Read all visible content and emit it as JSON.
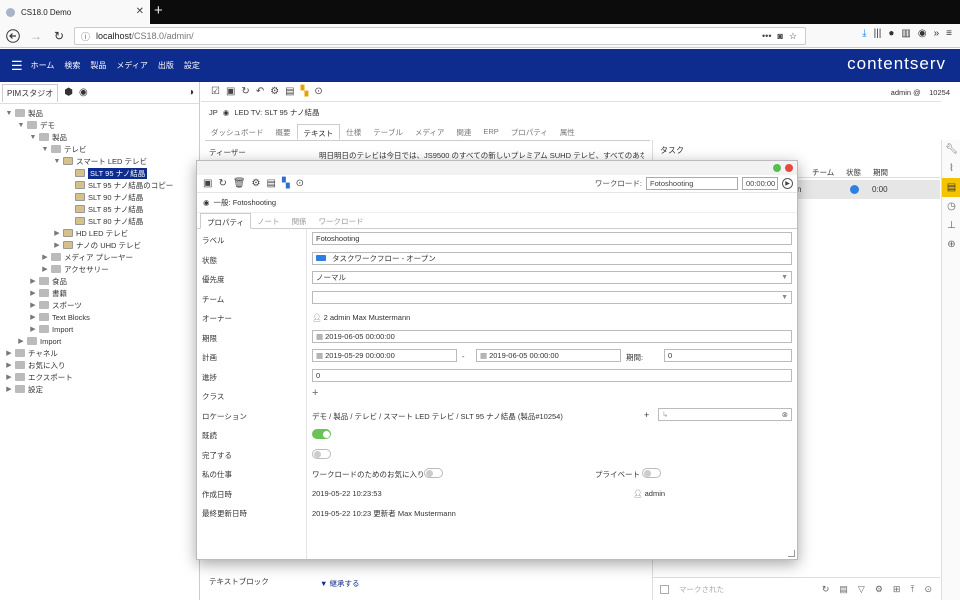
{
  "browser": {
    "tab_title": "CS18.0 Demo",
    "url_host": "localhost",
    "url_path": "/CS18.0/admin/"
  },
  "app": {
    "brand": "contentserv",
    "menu": [
      "ホーム",
      "検索",
      "製品",
      "メディア",
      "出版",
      "設定"
    ],
    "user": "admin @",
    "user_id": "10254"
  },
  "left": {
    "tab_label": "PIMスタジオ",
    "tree": [
      {
        "label": "製品",
        "toggle": "▼",
        "indent": 0
      },
      {
        "label": "デモ",
        "toggle": "▼",
        "indent": 1
      },
      {
        "label": "製品",
        "toggle": "▼",
        "indent": 2
      },
      {
        "label": "テレビ",
        "toggle": "▼",
        "indent": 3
      },
      {
        "label": "スマート LED テレビ",
        "toggle": "▼",
        "indent": 4
      },
      {
        "label": "SLT 95 ナノ結晶",
        "toggle": "",
        "indent": 5,
        "selected": true
      },
      {
        "label": "SLT 95 ナノ結晶のコピー",
        "toggle": "",
        "indent": 5
      },
      {
        "label": "SLT 90 ナノ結晶",
        "toggle": "",
        "indent": 5
      },
      {
        "label": "SLT 85 ナノ結晶",
        "toggle": "",
        "indent": 5
      },
      {
        "label": "SLT 80 ナノ結晶",
        "toggle": "",
        "indent": 5
      },
      {
        "label": "HD LED テレビ",
        "toggle": "▶",
        "indent": 4
      },
      {
        "label": "ナノの UHD テレビ",
        "toggle": "▶",
        "indent": 4
      },
      {
        "label": "メディア プレーヤー",
        "toggle": "▶",
        "indent": 3
      },
      {
        "label": "アクセサリー",
        "toggle": "▶",
        "indent": 3
      },
      {
        "label": "食品",
        "toggle": "▶",
        "indent": 2
      },
      {
        "label": "書籍",
        "toggle": "▶",
        "indent": 2
      },
      {
        "label": "スポーツ",
        "toggle": "▶",
        "indent": 2
      },
      {
        "label": "Text Blocks",
        "toggle": "▶",
        "indent": 2
      },
      {
        "label": "Import",
        "toggle": "▶",
        "indent": 2
      },
      {
        "label": "Import",
        "toggle": "▶",
        "indent": 1
      },
      {
        "label": "チャネル",
        "toggle": "▶",
        "indent": 0
      },
      {
        "label": "お気に入り",
        "toggle": "▶",
        "indent": 0
      },
      {
        "label": "エクスポート",
        "toggle": "▶",
        "indent": 0
      },
      {
        "label": "設定",
        "toggle": "▶",
        "indent": 0
      }
    ]
  },
  "main": {
    "lang": "JP",
    "object_title": "LED TV: SLT 95 ナノ結晶",
    "tabs": [
      "ダッシュボード",
      "概要",
      "テキスト",
      "仕様",
      "テーブル",
      "メディア",
      "関連",
      "ERP",
      "プロパティ",
      "属性"
    ],
    "active_tab": 2,
    "teaser_label": "ティーザー",
    "teaser_text": "明日明日のテレビは今日では、JS9500 のすべての新しいプレミアム SUHD テレビ、すべてのあなた",
    "text_block_label": "テキストブロック",
    "show_more": "▼ 継承する"
  },
  "tasks": {
    "title": "タスク",
    "headers": [
      "チーム",
      "状態",
      "期間"
    ],
    "row": {
      "duration": "0:00",
      "partial": "n"
    },
    "footer_placeholder": "マークされた"
  },
  "dialog": {
    "workload_label": "ワークロード:",
    "workload_value": "Fotoshooting",
    "time_value": "00:00:00",
    "subtitle": "一般: Fotoshooting",
    "tabs": [
      "プロパティ",
      "ノート",
      "関係",
      "ワークロード"
    ],
    "fields": {
      "label_lbl": "ラベル",
      "label_val": "Fotoshooting",
      "status_lbl": "状態",
      "status_val": "タスクワークフロー - オープン",
      "priority_lbl": "優先度",
      "priority_val": "ノーマル",
      "team_lbl": "チーム",
      "team_val": "",
      "owner_lbl": "オーナー",
      "owner_val": "2   admin   Max   Mustermann",
      "deadline_lbl": "期限",
      "deadline_val": "2019-06-05 00:00:00",
      "plan_lbl": "計画",
      "plan_start": "2019-05-29 00:00:00",
      "plan_sep": "-",
      "plan_end": "2019-06-05 00:00:00",
      "period_lbl": "期間:",
      "period_val": "0",
      "progress_lbl": "進捗",
      "progress_val": "0",
      "class_lbl": "クラス",
      "class_val": "+",
      "location_lbl": "ロケーション",
      "location_val": "デモ / 製品 / テレビ / スマート LED テレビ / SLT 95 ナノ結晶 (製品#10254)",
      "location_plus": "+",
      "read_lbl": "既読",
      "complete_lbl": "完了する",
      "mywork_lbl": "私の仕事",
      "favorite_lbl": "ワークロードのためのお気に入り",
      "private_lbl": "プライベート",
      "created_lbl": "作成日時",
      "created_val": "2019-05-22 10:23:53",
      "created_by": "admin",
      "updated_lbl": "最終更新日時",
      "updated_val": "2019-05-22 10:23 更新者 Max Mustermann"
    },
    "switches": {
      "read": true,
      "complete": false,
      "favorite": false,
      "private": false
    }
  }
}
